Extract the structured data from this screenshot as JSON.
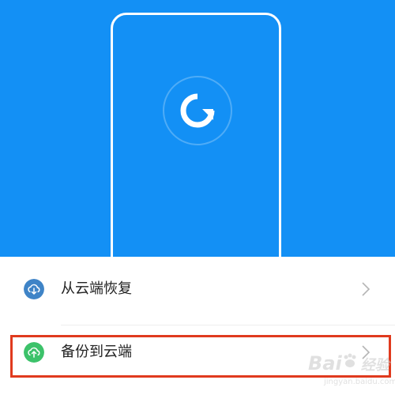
{
  "hero": {
    "background_color": "#1390f5",
    "icon": "sync-icon"
  },
  "menu": {
    "items": [
      {
        "label": "从云端恢复",
        "icon": "cloud-download-icon",
        "icon_color": "#3f84c7"
      },
      {
        "label": "备份到云端",
        "icon": "cloud-upload-icon",
        "icon_color": "#3cc26a"
      }
    ]
  },
  "annotation": {
    "highlight_color": "#e03a1e"
  },
  "watermark": {
    "text": "Bai",
    "suffix": "经验",
    "sub": "jingyan.baidu.com"
  }
}
